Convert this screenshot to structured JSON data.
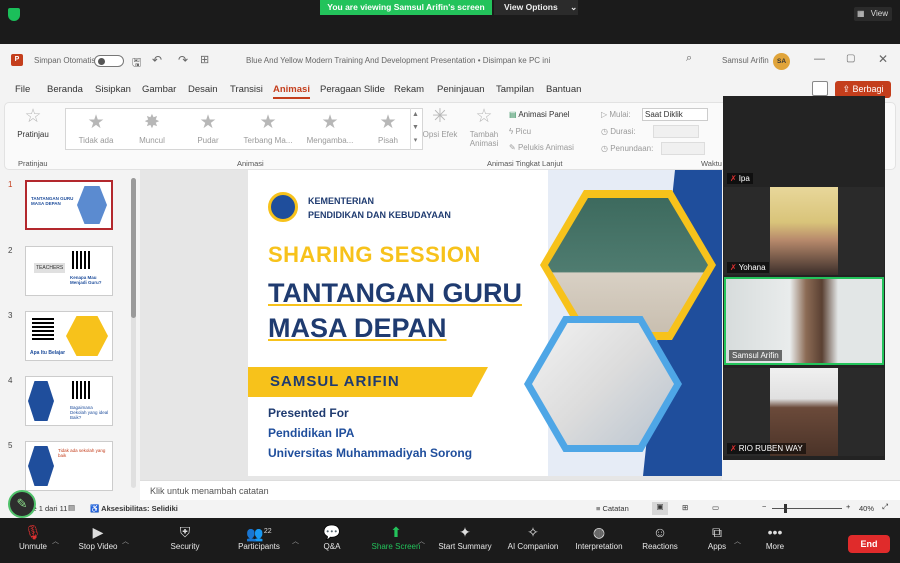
{
  "zoom_banner": {
    "viewing": "You are viewing Samsul Arifin's screen",
    "view_options": "View Options",
    "view": "View"
  },
  "ppt": {
    "autosave": "Simpan Otomatis",
    "doc_title": "Blue And Yellow Modern Training And Development Presentation • Disimpan ke PC ini",
    "user_name": "Samsul Arifin",
    "user_initials": "SA",
    "menu": [
      "File",
      "Beranda",
      "Sisipkan",
      "Gambar",
      "Desain",
      "Transisi",
      "Animasi",
      "Peragaan Slide",
      "Rekam",
      "Peninjauan",
      "Tampilan",
      "Bantuan"
    ],
    "share": "Berbagi",
    "ribbon": {
      "preview": "Pratinjau",
      "preview_group": "Pratinjau",
      "animations": [
        "Tidak ada",
        "Muncul",
        "Pudar",
        "Terbang Ma...",
        "Mengamba...",
        "Pisah"
      ],
      "effect_options": "Opsi Efek",
      "anim_group": "Animasi",
      "add_anim": "Tambah Animasi",
      "anim_pane": "Animasi Panel",
      "trigger": "Picu",
      "painter": "Pelukis Animasi",
      "advanced_group": "Animasi Tingkat Lanjut",
      "start_label": "Mulai:",
      "start_value": "Saat Diklik",
      "duration_label": "Durasi:",
      "delay_label": "Penundaan:",
      "timing_group": "Waktu"
    },
    "slide_numbers": [
      "1",
      "2",
      "3",
      "4",
      "5"
    ],
    "notes_placeholder": "Klik untuk menambah catatan",
    "status": {
      "slide": "Slide 1 dari 11",
      "accessibility": "Aksesibilitas: Selidiki",
      "notes": "Catatan",
      "zoom": "40%"
    }
  },
  "slide": {
    "ministry": [
      "KEMENTERIAN",
      "PENDIDIKAN DAN KEBUDAYAAN"
    ],
    "session": "SHARING SESSION",
    "title1": "TANTANGAN GURU",
    "title2": "MASA DEPAN",
    "presenter": "SAMSUL ARIFIN",
    "presented_for": "Presented For",
    "program": "Pendidikan IPA",
    "university": "Universitas Muhammadiyah Sorong"
  },
  "thumb_texts": {
    "t1": "TANTANGAN GURU MASA DEPAN",
    "t2a": "TEACHERS",
    "t2b": "Kenapa Mau Menjadi Guru?",
    "t3": "Apa Itu Belajar",
    "t4": "Bagaimana Dekolah yang ideal Baik?",
    "t5": "Tidak ada sekolah yang baik"
  },
  "participants": [
    {
      "name": "Ipa"
    },
    {
      "name": "Yohana"
    },
    {
      "name": "Samsul Arifin"
    },
    {
      "name": "RIO RUBEN WAY"
    }
  ],
  "toolbar": {
    "unmute": "Unmute",
    "stop_video": "Stop Video",
    "security": "Security",
    "participants": "Participants",
    "participants_count": "22",
    "qa": "Q&A",
    "share_screen": "Share Screen",
    "summary": "Start Summary",
    "ai": "AI Companion",
    "interpretation": "Interpretation",
    "reactions": "Reactions",
    "apps": "Apps",
    "more": "More",
    "end": "End"
  },
  "colors": {
    "zoom_green": "#23c35b",
    "ppt_accent": "#c43e1c",
    "slide_yellow": "#f7c21b",
    "slide_blue": "#1f4e9c",
    "end_red": "#e02b2b"
  }
}
